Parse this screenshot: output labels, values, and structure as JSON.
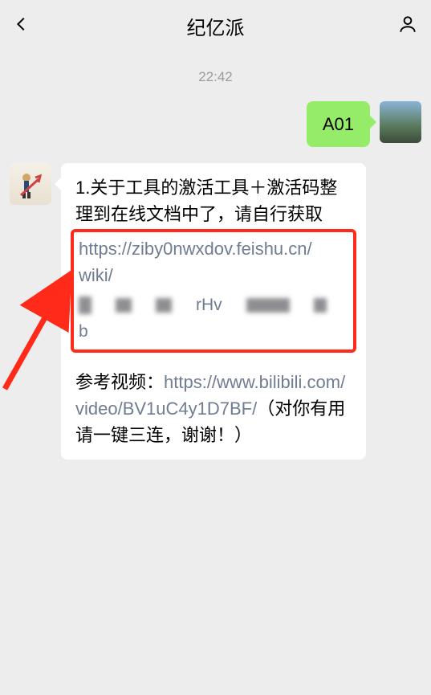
{
  "header": {
    "title": "纪亿派"
  },
  "timestamp": "22:42",
  "messages": {
    "outgoing": {
      "text": "A01"
    },
    "incoming": {
      "line1": "1.关于工具的激活工具＋激活码整理到在线文档中了，请自行获取",
      "link1_a": "https://ziby0nwxdov.feishu.cn/",
      "link1_b": "wiki/",
      "censored_mid_text": "rHv",
      "censored_tail": "b",
      "ref_label": "参考视频：",
      "ref_link": "https://www.bilibili.com/video/BV1uC4y1D7BF/",
      "ref_tail": "（对你有用请一键三连，谢谢！）"
    }
  }
}
